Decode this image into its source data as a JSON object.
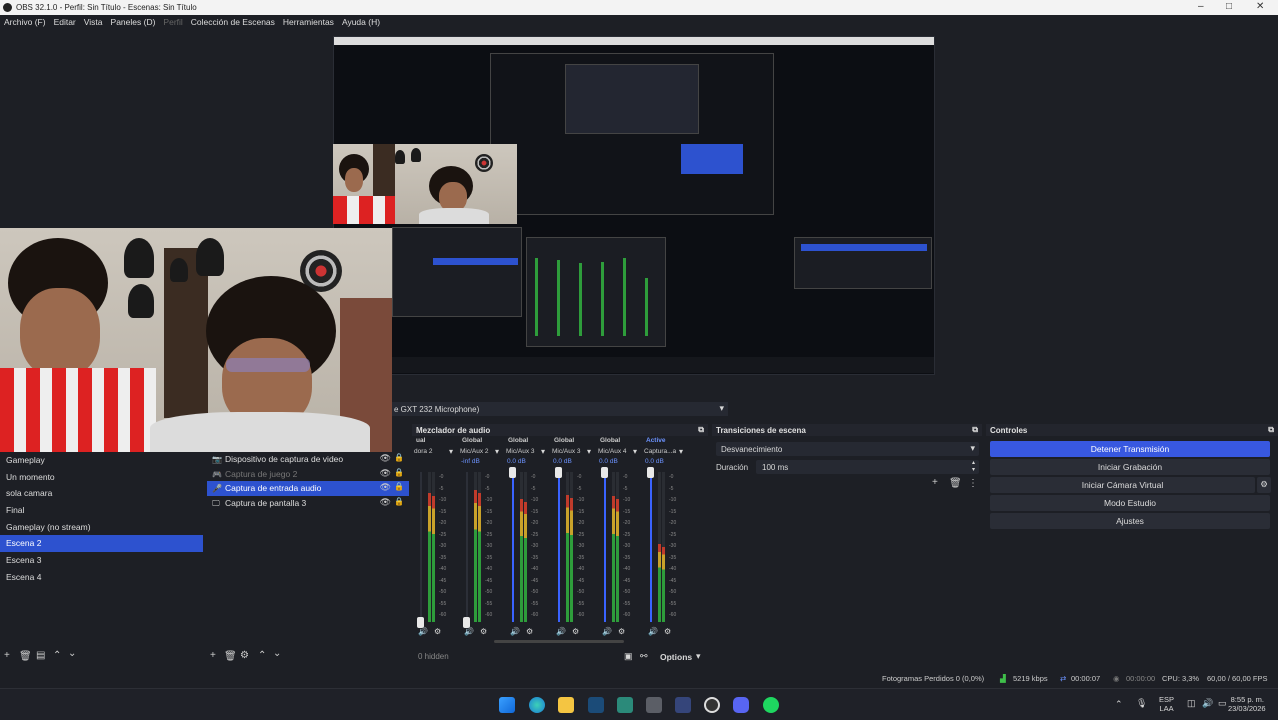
{
  "titlebar": {
    "title": "OBS 32.1.0 - Perfil: Sin Título - Escenas: Sin Título"
  },
  "menu": [
    "Archivo (F)",
    "Editar",
    "Vista",
    "Paneles (D)",
    "Perfil",
    "Colección de Escenas",
    "Herramientas",
    "Ayuda (H)"
  ],
  "audio_source_bar": {
    "label": "e GXT 232 Microphone)"
  },
  "scenes": {
    "items": [
      "Gameplay",
      "Un momento",
      "sola camara",
      "Final",
      "Gameplay (no stream)",
      "Escena 2",
      "Escena 3",
      "Escena 4"
    ],
    "selected": "Escena 2"
  },
  "sources": {
    "items": [
      {
        "label": "Dispositivo de captura de video",
        "icon": "camera-icon",
        "dim": false
      },
      {
        "label": "Captura de juego 2",
        "icon": "gamepad-icon",
        "dim": true
      },
      {
        "label": "Captura de entrada audio",
        "icon": "microphone-icon",
        "dim": false
      },
      {
        "label": "Captura de pantalla 3",
        "icon": "monitor-icon",
        "dim": false
      }
    ],
    "selected": "Captura de entrada audio"
  },
  "mixer": {
    "title": "Mezclador de audio",
    "hidden_label": "0 hidden",
    "options_label": "Options",
    "scale": [
      "-0",
      "-5",
      "-10",
      "-15",
      "-20",
      "-25",
      "-30",
      "-35",
      "-40",
      "-45",
      "-50",
      "-55",
      "-60"
    ],
    "channels": [
      {
        "group": "ual",
        "name": "dora 2",
        "db": "",
        "level": 0.86,
        "fader": 0.0
      },
      {
        "group": "Global",
        "name": "Mic/Aux 2",
        "db": "-inf dB",
        "level": 0.88,
        "fader": 0.0
      },
      {
        "group": "Global",
        "name": "Mic/Aux 3",
        "db": "0.0 dB",
        "level": 0.82,
        "fader": 1.0
      },
      {
        "group": "Global",
        "name": "Mic/Aux 3",
        "db": "0.0 dB",
        "level": 0.85,
        "fader": 1.0
      },
      {
        "group": "Global",
        "name": "Mic/Aux 4",
        "db": "0.0 dB",
        "level": 0.84,
        "fader": 1.0
      },
      {
        "group": "Active",
        "name": "Captura...a audio",
        "db": "0.0 dB",
        "level": 0.52,
        "fader": 1.0
      }
    ]
  },
  "transitions": {
    "title": "Transiciones de escena",
    "selected": "Desvanecimiento",
    "duration_label": "Duración",
    "duration_value": "100 ms"
  },
  "controls": {
    "title": "Controles",
    "buttons": [
      "Detener Transmisión",
      "Iniciar Grabación",
      "Iniciar Cámara Virtual",
      "Modo Estudio",
      "Ajustes"
    ]
  },
  "status": {
    "dropped": "Fotogramas Perdidos 0 (0,0%)",
    "bitrate": "5219 kbps",
    "stream_time": "00:00:07",
    "rec_time": "00:00:00",
    "cpu": "CPU: 3,3%",
    "fps": "60,00 / 60,00 FPS"
  },
  "taskbar": {
    "lang": "ESP",
    "region": "LAA",
    "time": "8:55 p. m.",
    "date": "23/03/2026"
  },
  "colors": {
    "accent": "#2d52cf",
    "bg": "#1d1f25",
    "meter_green": "#2e9d3b",
    "meter_yellow": "#c9a22a",
    "meter_red": "#c03b2b",
    "fader": "#3a63ff"
  }
}
